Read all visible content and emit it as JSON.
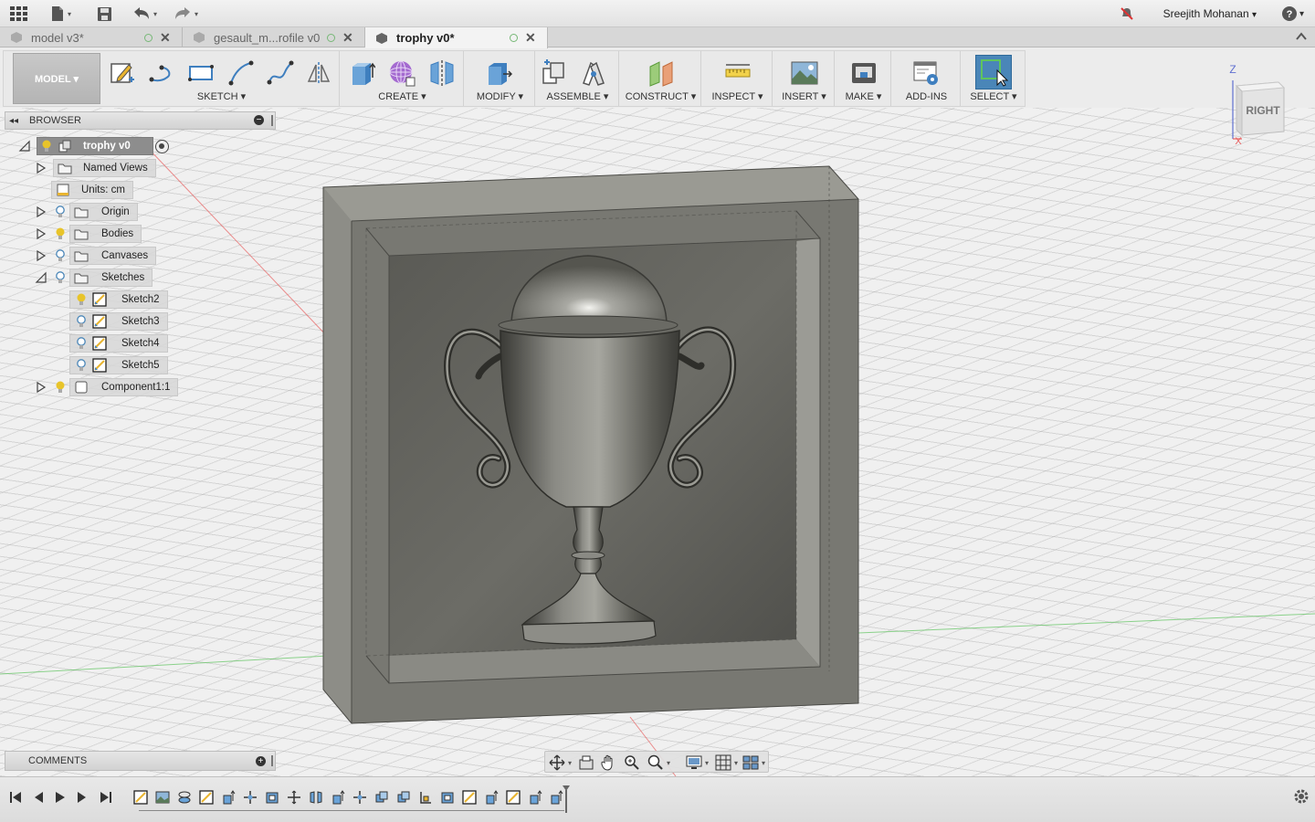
{
  "topbar": {
    "icons": [
      "apps-grid-icon",
      "file-icon",
      "save-icon",
      "undo-icon",
      "redo-icon",
      "notifications-off-icon",
      "help-icon"
    ],
    "user_name": "Sreejith Mohanan",
    "user_caret": "▾",
    "help_caret": "▾"
  },
  "tabs": [
    {
      "label": "model v3*",
      "active": false
    },
    {
      "label": "gesault_m...rofile v0",
      "active": false
    },
    {
      "label": "trophy v0*",
      "active": true
    }
  ],
  "toolbar": {
    "workspace": "MODEL ▾",
    "groups": [
      {
        "label": "SKETCH ▾",
        "tools": [
          "create-sketch-icon",
          "line-icon",
          "rectangle-icon",
          "arc-icon",
          "spline-icon",
          "mirror-sketch-icon"
        ]
      },
      {
        "label": "CREATE ▾",
        "tools": [
          "extrude-icon",
          "form-icon",
          "mirror-icon"
        ]
      },
      {
        "label": "MODIFY ▾",
        "tools": [
          "press-pull-icon"
        ]
      },
      {
        "label": "ASSEMBLE ▾",
        "tools": [
          "new-component-icon",
          "joint-icon"
        ]
      },
      {
        "label": "CONSTRUCT ▾",
        "tools": [
          "offset-plane-icon"
        ]
      },
      {
        "label": "INSPECT ▾",
        "tools": [
          "measure-icon"
        ]
      },
      {
        "label": "INSERT ▾",
        "tools": [
          "insert-image-icon"
        ]
      },
      {
        "label": "MAKE ▾",
        "tools": [
          "print-3d-icon"
        ]
      },
      {
        "label": "ADD-INS",
        "tools": [
          "scripts-addins-icon"
        ]
      },
      {
        "label": "SELECT ▾",
        "tools": [
          "select-icon"
        ]
      }
    ]
  },
  "browser": {
    "title": "BROWSER",
    "root": "trophy v0",
    "items": [
      {
        "label": "Named Views"
      },
      {
        "label": "Units: cm"
      },
      {
        "label": "Origin"
      },
      {
        "label": "Bodies"
      },
      {
        "label": "Canvases"
      },
      {
        "label": "Sketches"
      },
      {
        "label": "Sketch2"
      },
      {
        "label": "Sketch3"
      },
      {
        "label": "Sketch4"
      },
      {
        "label": "Sketch5"
      },
      {
        "label": "Component1:1"
      }
    ]
  },
  "viewcube": {
    "face": "RIGHT",
    "z_label": "Z",
    "x_label": "X"
  },
  "comments": {
    "title": "COMMENTS"
  },
  "colors": {
    "accent_blue": "#3f7fbf",
    "bulb_on": "#e8c42a",
    "select_active": "#4a86b8",
    "axis_red": "#e86060",
    "axis_green": "#5fc45f",
    "box_shell": "#787872"
  }
}
